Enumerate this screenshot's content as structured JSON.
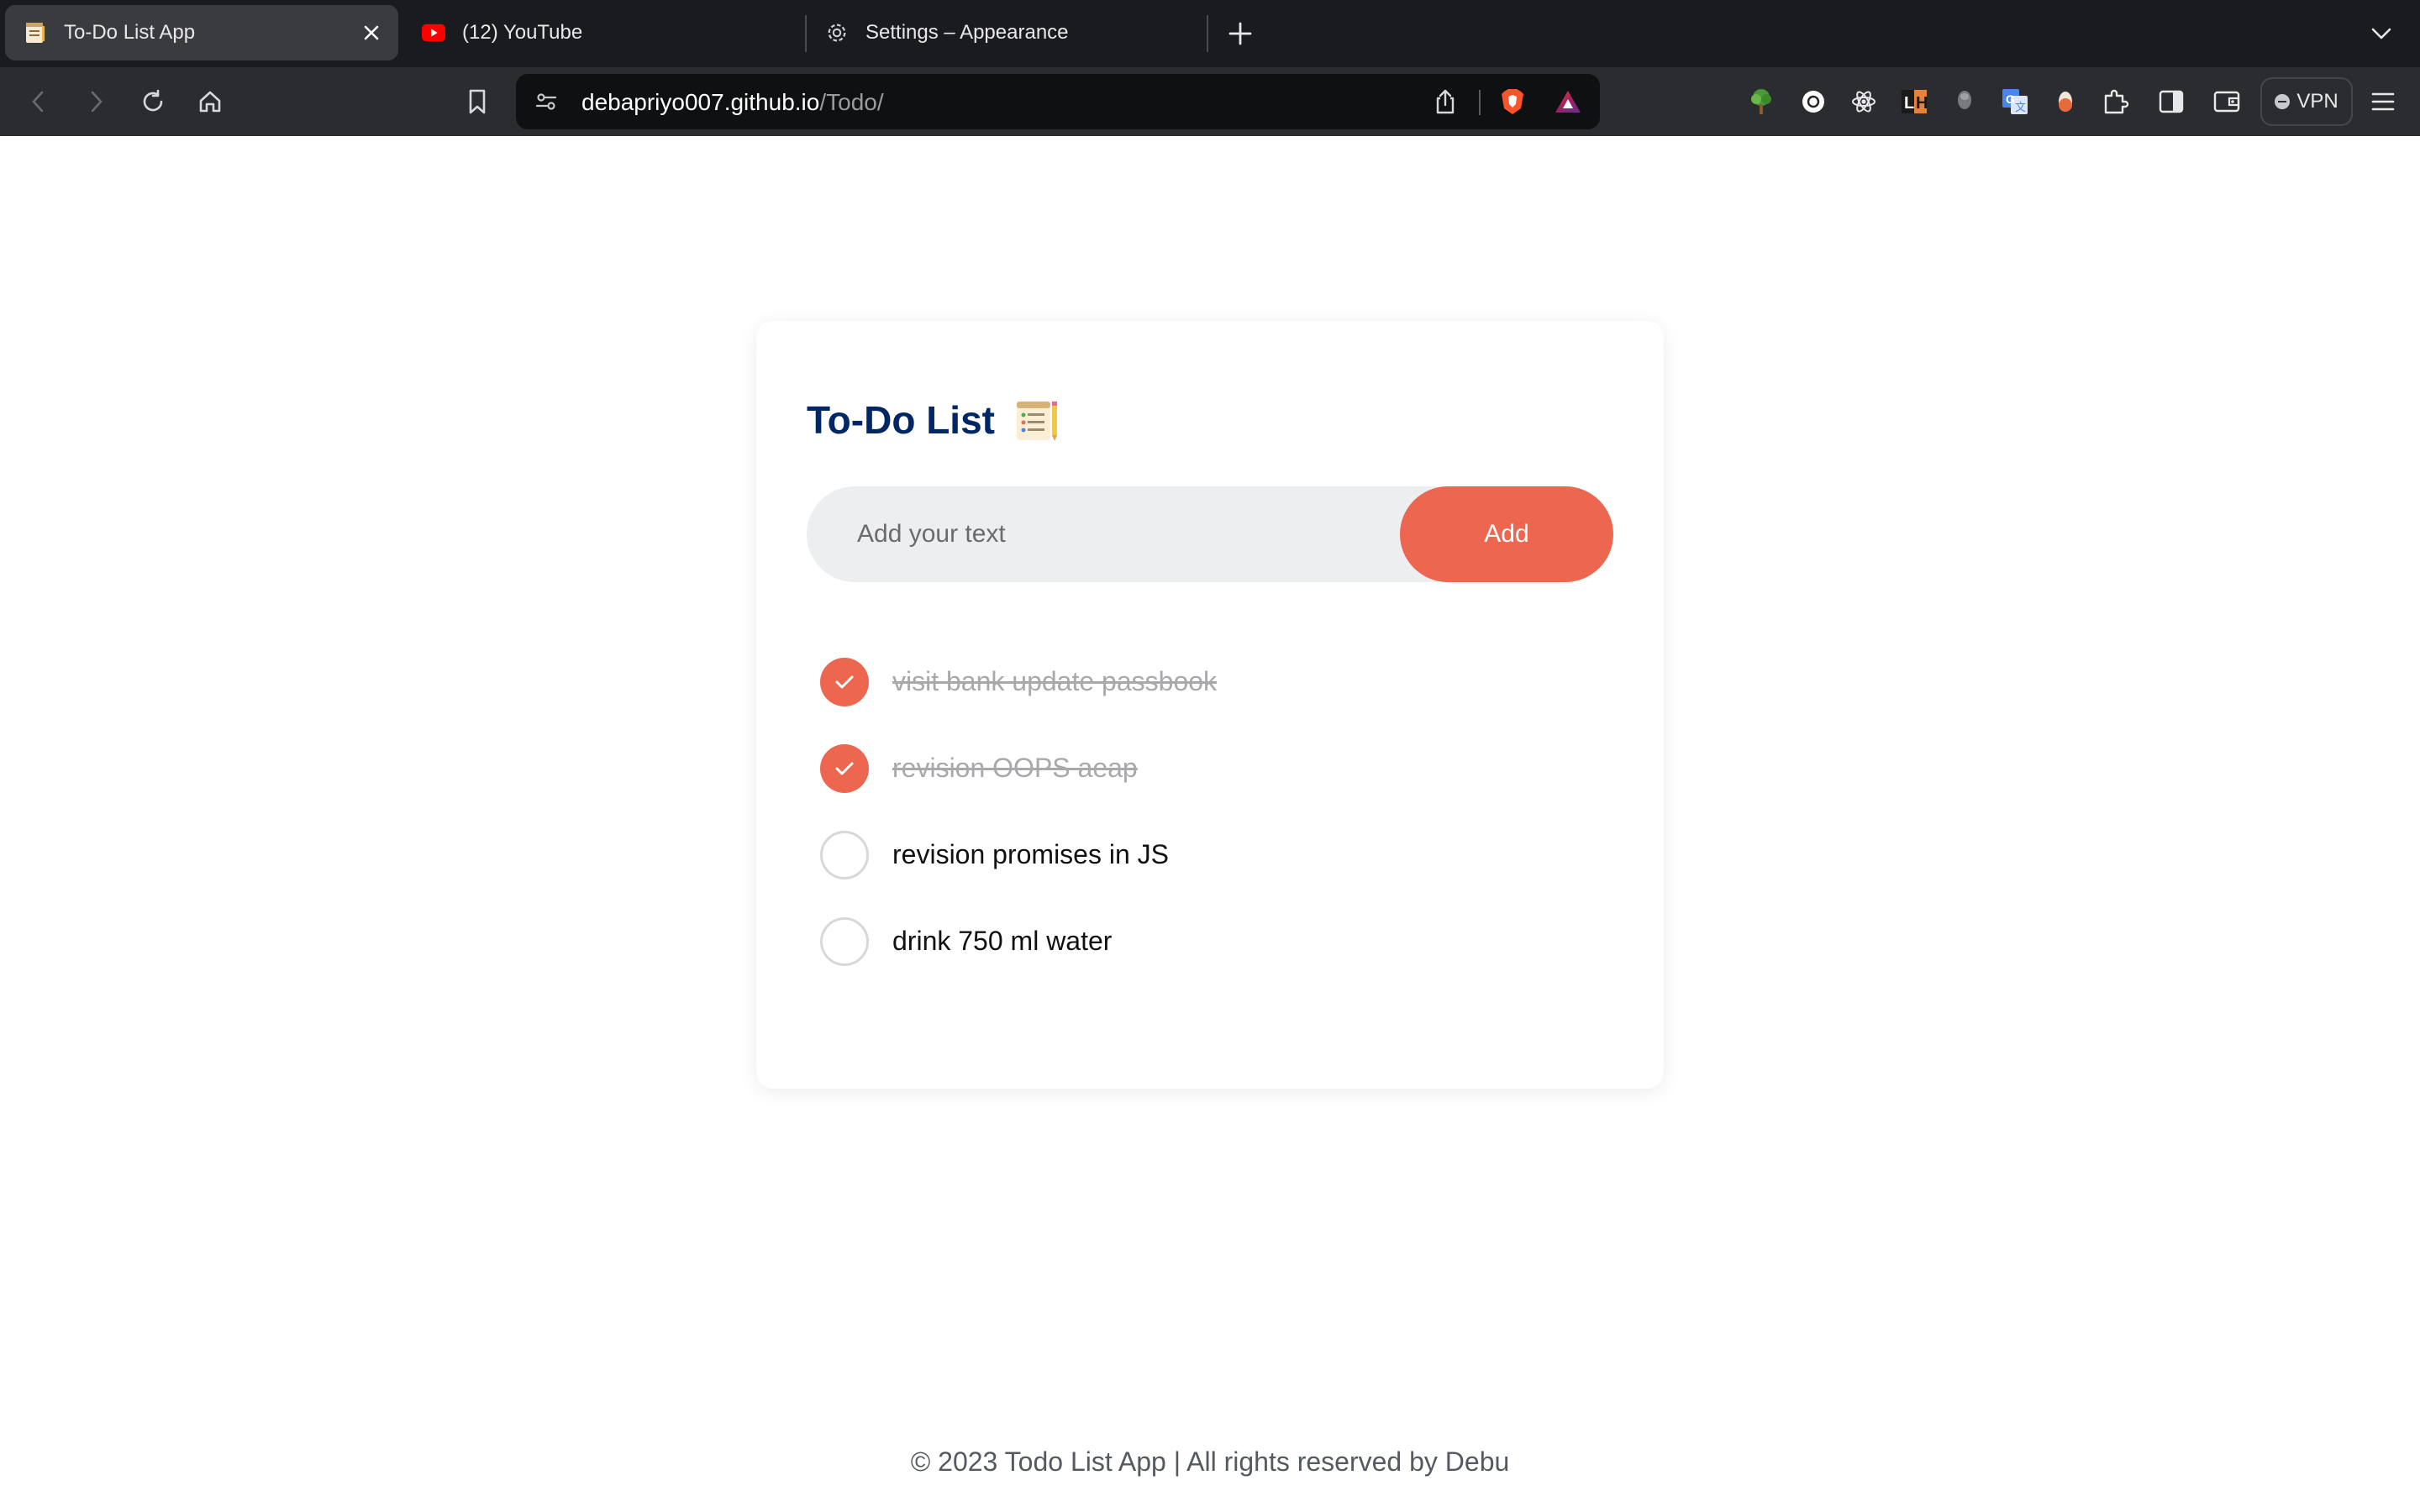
{
  "browser": {
    "tabs": [
      {
        "label": "To-Do List App",
        "icon": "notepad-icon",
        "active": true
      },
      {
        "label": "(12) YouTube",
        "icon": "youtube-icon",
        "active": false
      },
      {
        "label": "Settings – Appearance",
        "icon": "gear-icon",
        "active": false
      }
    ],
    "address": {
      "host": "debapriyo007.github.io",
      "path": "/Todo/"
    },
    "vpn_label": "VPN",
    "extensions": [
      "tree-extension-icon",
      "circle-extension-icon",
      "react-devtools-icon",
      "lighthouse-extension-icon",
      "pin-extension-icon",
      "translate-extension-icon",
      "capsule-extension-icon",
      "puzzle-extensions-icon",
      "sidebar-icon",
      "wallet-icon"
    ]
  },
  "app": {
    "title": "To-Do List",
    "input_placeholder": "Add your text",
    "add_label": "Add",
    "items": [
      {
        "text": "visit bank update passbook",
        "done": true
      },
      {
        "text": "revision OOPS aeap",
        "done": true
      },
      {
        "text": "revision promises in JS",
        "done": false
      },
      {
        "text": "drink 750 ml water",
        "done": false
      }
    ],
    "footer": "© 2023 Todo List App | All rights reserved by Debu"
  },
  "colors": {
    "accent": "#ed6650",
    "title": "#002765",
    "input_bg": "#edeef0",
    "chrome_dark": "#1a1b1e",
    "toolbar": "#2b2c30"
  }
}
